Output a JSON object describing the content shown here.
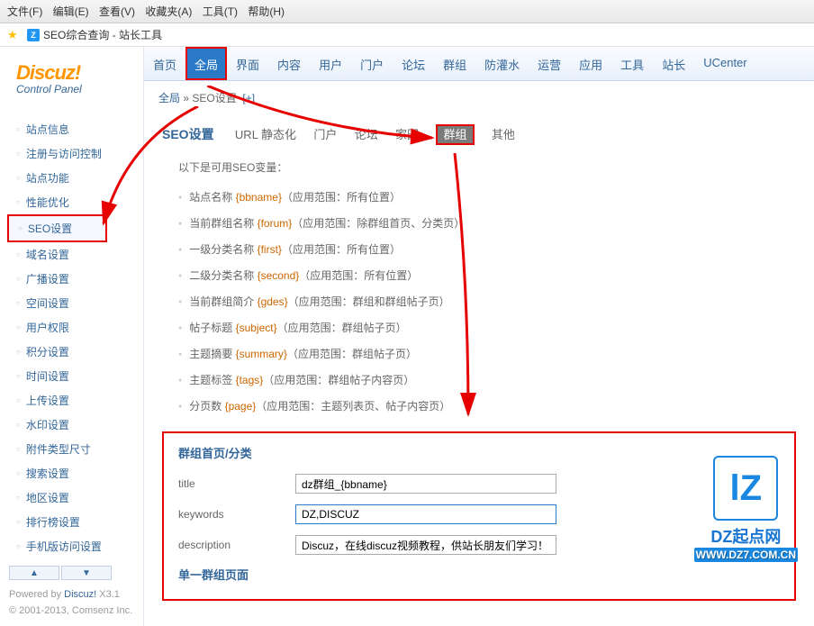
{
  "browser": {
    "menu": [
      "文件(F)",
      "编辑(E)",
      "查看(V)",
      "收藏夹(A)",
      "工具(T)",
      "帮助(H)"
    ],
    "bookmark": "SEO综合查询 - 站长工具"
  },
  "logo": {
    "main": "Discuz!",
    "sub": "Control Panel"
  },
  "sidebar": {
    "items": [
      "站点信息",
      "注册与访问控制",
      "站点功能",
      "性能优化",
      "SEO设置",
      "域名设置",
      "广播设置",
      "空间设置",
      "用户权限",
      "积分设置",
      "时间设置",
      "上传设置",
      "水印设置",
      "附件类型尺寸",
      "搜索设置",
      "地区设置",
      "排行榜设置",
      "手机版访问设置"
    ]
  },
  "footer": {
    "line1_prefix": "Powered by ",
    "line1_link": "Discuz!",
    "line1_suffix": " X3.1",
    "line2": "© 2001-2013, Comsenz Inc."
  },
  "topnav": [
    "首页",
    "全局",
    "界面",
    "内容",
    "用户",
    "门户",
    "论坛",
    "群组",
    "防灌水",
    "运营",
    "应用",
    "工具",
    "站长",
    "UCenter"
  ],
  "breadcrumb": {
    "a": "全局",
    "sep": "»",
    "b": "SEO设置",
    "plus": "[+]"
  },
  "subnav": {
    "title": "SEO设置",
    "items": [
      "URL 静态化",
      "门户",
      "论坛",
      "家园",
      "群组",
      "其他"
    ]
  },
  "intro": "以下是可用SEO变量：",
  "vars": [
    {
      "label": "站点名称 ",
      "code": "{bbname}",
      "desc": "（应用范围：所有位置）"
    },
    {
      "label": "当前群组名称 ",
      "code": "{forum}",
      "desc": "（应用范围：除群组首页、分类页）"
    },
    {
      "label": "一级分类名称 ",
      "code": "{first}",
      "desc": "（应用范围：所有位置）"
    },
    {
      "label": "二级分类名称 ",
      "code": "{second}",
      "desc": "（应用范围：所有位置）"
    },
    {
      "label": "当前群组简介 ",
      "code": "{gdes}",
      "desc": "（应用范围：群组和群组帖子页）"
    },
    {
      "label": "帖子标题 ",
      "code": "{subject}",
      "desc": "（应用范围：群组帖子页）"
    },
    {
      "label": "主题摘要 ",
      "code": "{summary}",
      "desc": "（应用范围：群组帖子页）"
    },
    {
      "label": "主题标签 ",
      "code": "{tags}",
      "desc": "（应用范围：群组帖子内容页）"
    },
    {
      "label": "分页数 ",
      "code": "{page}",
      "desc": "（应用范围：主题列表页、帖子内容页）"
    }
  ],
  "form": {
    "section1": "群组首页/分类",
    "rows": [
      {
        "label": "title",
        "value": "dz群组_{bbname}"
      },
      {
        "label": "keywords",
        "value": "DZ,DISCUZ"
      },
      {
        "label": "description",
        "value": "Discuz，在线discuz视频教程，供站长朋友们学习！"
      }
    ],
    "section2": "单一群组页面"
  },
  "watermark": {
    "logo": "lZ",
    "t1": "DZ起点网",
    "t2": "WWW.DZ7.COM.CN"
  }
}
